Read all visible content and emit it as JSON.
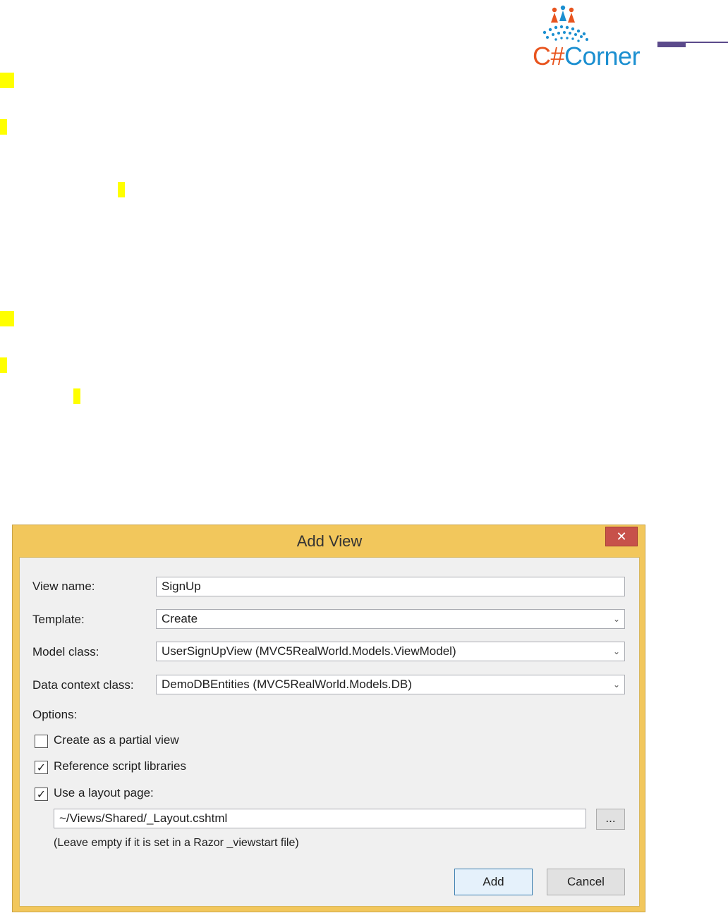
{
  "header": {
    "logo_c": "C#",
    "logo_rest": "Corner"
  },
  "dialog": {
    "title": "Add View",
    "close_glyph": "✕",
    "view_name_label": "View name:",
    "view_name_value": "SignUp",
    "template_label": "Template:",
    "template_value": "Create",
    "model_class_label": "Model class:",
    "model_class_value": "UserSignUpView (MVC5RealWorld.Models.ViewModel)",
    "data_context_label": "Data context class:",
    "data_context_value": "DemoDBEntities (MVC5RealWorld.Models.DB)",
    "options_label": "Options:",
    "partial_view_label": "Create as a partial view",
    "partial_view_checked": false,
    "reference_scripts_label": "Reference script libraries",
    "reference_scripts_checked": true,
    "layout_page_label": "Use a layout page:",
    "layout_page_checked": true,
    "layout_path_value": "~/Views/Shared/_Layout.cshtml",
    "browse_label": "...",
    "hint": "(Leave empty if it is set in a Razor _viewstart file)",
    "add_label": "Add",
    "cancel_label": "Cancel",
    "check_glyph": "✓",
    "chevron_glyph": "⌄"
  },
  "colors": {
    "highlight": "#ffff00",
    "dialog_frame": "#f2c75c",
    "close_button": "#c7514a",
    "logo_orange": "#e8541e",
    "logo_blue": "#1b8fd0"
  }
}
